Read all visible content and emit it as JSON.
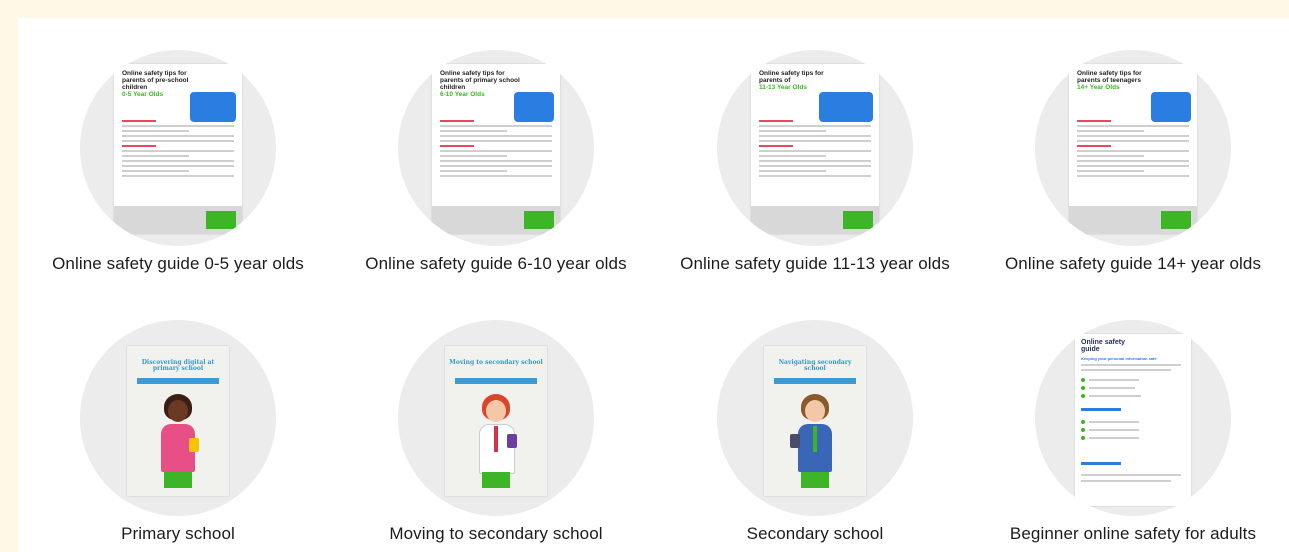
{
  "guides": [
    {
      "label": "Online safety guide 0-5 year olds",
      "doc": {
        "title": "Online safety tips for parents of pre-school children",
        "age": "0-5 Year Olds"
      }
    },
    {
      "label": "Online safety guide 6-10 year olds",
      "doc": {
        "title": "Online safety tips for parents of primary school children",
        "age": "6-10 Year Olds"
      }
    },
    {
      "label": "Online safety guide 11-13 year olds",
      "doc": {
        "title": "Online safety tips for parents of",
        "age": "11-13 Year Olds"
      }
    },
    {
      "label": "Online safety guide 14+ year olds",
      "doc": {
        "title": "Online safety tips for parents of teenagers",
        "age": "14+ Year Olds"
      }
    },
    {
      "label": "Primary school",
      "doc": {
        "title": "Discovering digital at primary school"
      }
    },
    {
      "label": "Moving to secondary school",
      "doc": {
        "title": "Moving to secondary school"
      }
    },
    {
      "label": "Secondary school",
      "doc": {
        "title": "Navigating secondary school"
      }
    },
    {
      "label": "Beginner online safety for adults",
      "doc": {
        "title": "Online safety guide",
        "subtitle": "Keeping your personal information safe"
      }
    }
  ],
  "colors": {
    "accent_green": "#3cb526",
    "accent_blue": "#2a7de1",
    "page_bg": "#fff8e6",
    "circle_bg": "#ececec"
  }
}
